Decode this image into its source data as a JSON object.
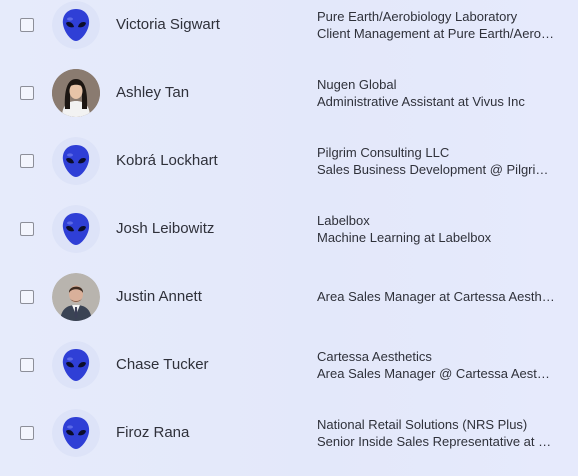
{
  "contacts": [
    {
      "name": "Victoria Sigwart",
      "company": "Pure Earth/Aerobiology Laboratory",
      "title": "Client Management at Pure Earth/Aerobiology Laboratory",
      "avatar": "alien-avatar-icon"
    },
    {
      "name": "Ashley Tan",
      "company": "Nugen Global",
      "title": "Administrative Assistant at Vivus Inc",
      "avatar": "photo-avatar-woman"
    },
    {
      "name": "Kobrá Lockhart",
      "company": "Pilgrim Consulting LLC",
      "title": "Sales Business Development @ Pilgrim Consulting LLC",
      "avatar": "alien-avatar-icon"
    },
    {
      "name": "Josh Leibowitz",
      "company": "Labelbox",
      "title": "Machine Learning at Labelbox",
      "avatar": "alien-avatar-icon"
    },
    {
      "name": "Justin Annett",
      "company": "",
      "title": "Area Sales Manager at Cartessa Aesthetics",
      "avatar": "photo-avatar-man"
    },
    {
      "name": "Chase Tucker",
      "company": "Cartessa Aesthetics",
      "title": "Area Sales Manager @ Cartessa Aesthetics",
      "avatar": "alien-avatar-icon"
    },
    {
      "name": "Firoz Rana",
      "company": "National Retail Solutions (NRS Plus)",
      "title": "Senior Inside Sales Representative at National Retail Solutions",
      "avatar": "alien-avatar-icon"
    }
  ],
  "colors": {
    "background": "#e4e9fb",
    "alien_blue": "#2f3fd6",
    "text": "#2f313a"
  }
}
